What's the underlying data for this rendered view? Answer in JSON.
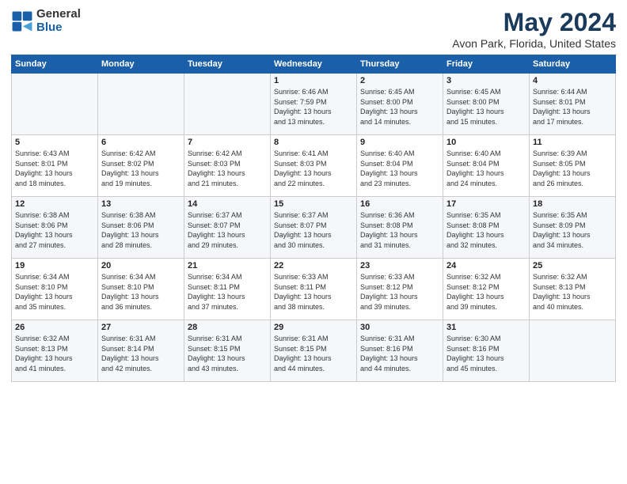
{
  "logo": {
    "general": "General",
    "blue": "Blue"
  },
  "title": "May 2024",
  "subtitle": "Avon Park, Florida, United States",
  "days_of_week": [
    "Sunday",
    "Monday",
    "Tuesday",
    "Wednesday",
    "Thursday",
    "Friday",
    "Saturday"
  ],
  "weeks": [
    [
      {
        "day": "",
        "content": ""
      },
      {
        "day": "",
        "content": ""
      },
      {
        "day": "",
        "content": ""
      },
      {
        "day": "1",
        "content": "Sunrise: 6:46 AM\nSunset: 7:59 PM\nDaylight: 13 hours\nand 13 minutes."
      },
      {
        "day": "2",
        "content": "Sunrise: 6:45 AM\nSunset: 8:00 PM\nDaylight: 13 hours\nand 14 minutes."
      },
      {
        "day": "3",
        "content": "Sunrise: 6:45 AM\nSunset: 8:00 PM\nDaylight: 13 hours\nand 15 minutes."
      },
      {
        "day": "4",
        "content": "Sunrise: 6:44 AM\nSunset: 8:01 PM\nDaylight: 13 hours\nand 17 minutes."
      }
    ],
    [
      {
        "day": "5",
        "content": "Sunrise: 6:43 AM\nSunset: 8:01 PM\nDaylight: 13 hours\nand 18 minutes."
      },
      {
        "day": "6",
        "content": "Sunrise: 6:42 AM\nSunset: 8:02 PM\nDaylight: 13 hours\nand 19 minutes."
      },
      {
        "day": "7",
        "content": "Sunrise: 6:42 AM\nSunset: 8:03 PM\nDaylight: 13 hours\nand 21 minutes."
      },
      {
        "day": "8",
        "content": "Sunrise: 6:41 AM\nSunset: 8:03 PM\nDaylight: 13 hours\nand 22 minutes."
      },
      {
        "day": "9",
        "content": "Sunrise: 6:40 AM\nSunset: 8:04 PM\nDaylight: 13 hours\nand 23 minutes."
      },
      {
        "day": "10",
        "content": "Sunrise: 6:40 AM\nSunset: 8:04 PM\nDaylight: 13 hours\nand 24 minutes."
      },
      {
        "day": "11",
        "content": "Sunrise: 6:39 AM\nSunset: 8:05 PM\nDaylight: 13 hours\nand 26 minutes."
      }
    ],
    [
      {
        "day": "12",
        "content": "Sunrise: 6:38 AM\nSunset: 8:06 PM\nDaylight: 13 hours\nand 27 minutes."
      },
      {
        "day": "13",
        "content": "Sunrise: 6:38 AM\nSunset: 8:06 PM\nDaylight: 13 hours\nand 28 minutes."
      },
      {
        "day": "14",
        "content": "Sunrise: 6:37 AM\nSunset: 8:07 PM\nDaylight: 13 hours\nand 29 minutes."
      },
      {
        "day": "15",
        "content": "Sunrise: 6:37 AM\nSunset: 8:07 PM\nDaylight: 13 hours\nand 30 minutes."
      },
      {
        "day": "16",
        "content": "Sunrise: 6:36 AM\nSunset: 8:08 PM\nDaylight: 13 hours\nand 31 minutes."
      },
      {
        "day": "17",
        "content": "Sunrise: 6:35 AM\nSunset: 8:08 PM\nDaylight: 13 hours\nand 32 minutes."
      },
      {
        "day": "18",
        "content": "Sunrise: 6:35 AM\nSunset: 8:09 PM\nDaylight: 13 hours\nand 34 minutes."
      }
    ],
    [
      {
        "day": "19",
        "content": "Sunrise: 6:34 AM\nSunset: 8:10 PM\nDaylight: 13 hours\nand 35 minutes."
      },
      {
        "day": "20",
        "content": "Sunrise: 6:34 AM\nSunset: 8:10 PM\nDaylight: 13 hours\nand 36 minutes."
      },
      {
        "day": "21",
        "content": "Sunrise: 6:34 AM\nSunset: 8:11 PM\nDaylight: 13 hours\nand 37 minutes."
      },
      {
        "day": "22",
        "content": "Sunrise: 6:33 AM\nSunset: 8:11 PM\nDaylight: 13 hours\nand 38 minutes."
      },
      {
        "day": "23",
        "content": "Sunrise: 6:33 AM\nSunset: 8:12 PM\nDaylight: 13 hours\nand 39 minutes."
      },
      {
        "day": "24",
        "content": "Sunrise: 6:32 AM\nSunset: 8:12 PM\nDaylight: 13 hours\nand 39 minutes."
      },
      {
        "day": "25",
        "content": "Sunrise: 6:32 AM\nSunset: 8:13 PM\nDaylight: 13 hours\nand 40 minutes."
      }
    ],
    [
      {
        "day": "26",
        "content": "Sunrise: 6:32 AM\nSunset: 8:13 PM\nDaylight: 13 hours\nand 41 minutes."
      },
      {
        "day": "27",
        "content": "Sunrise: 6:31 AM\nSunset: 8:14 PM\nDaylight: 13 hours\nand 42 minutes."
      },
      {
        "day": "28",
        "content": "Sunrise: 6:31 AM\nSunset: 8:15 PM\nDaylight: 13 hours\nand 43 minutes."
      },
      {
        "day": "29",
        "content": "Sunrise: 6:31 AM\nSunset: 8:15 PM\nDaylight: 13 hours\nand 44 minutes."
      },
      {
        "day": "30",
        "content": "Sunrise: 6:31 AM\nSunset: 8:16 PM\nDaylight: 13 hours\nand 44 minutes."
      },
      {
        "day": "31",
        "content": "Sunrise: 6:30 AM\nSunset: 8:16 PM\nDaylight: 13 hours\nand 45 minutes."
      },
      {
        "day": "",
        "content": ""
      }
    ]
  ]
}
